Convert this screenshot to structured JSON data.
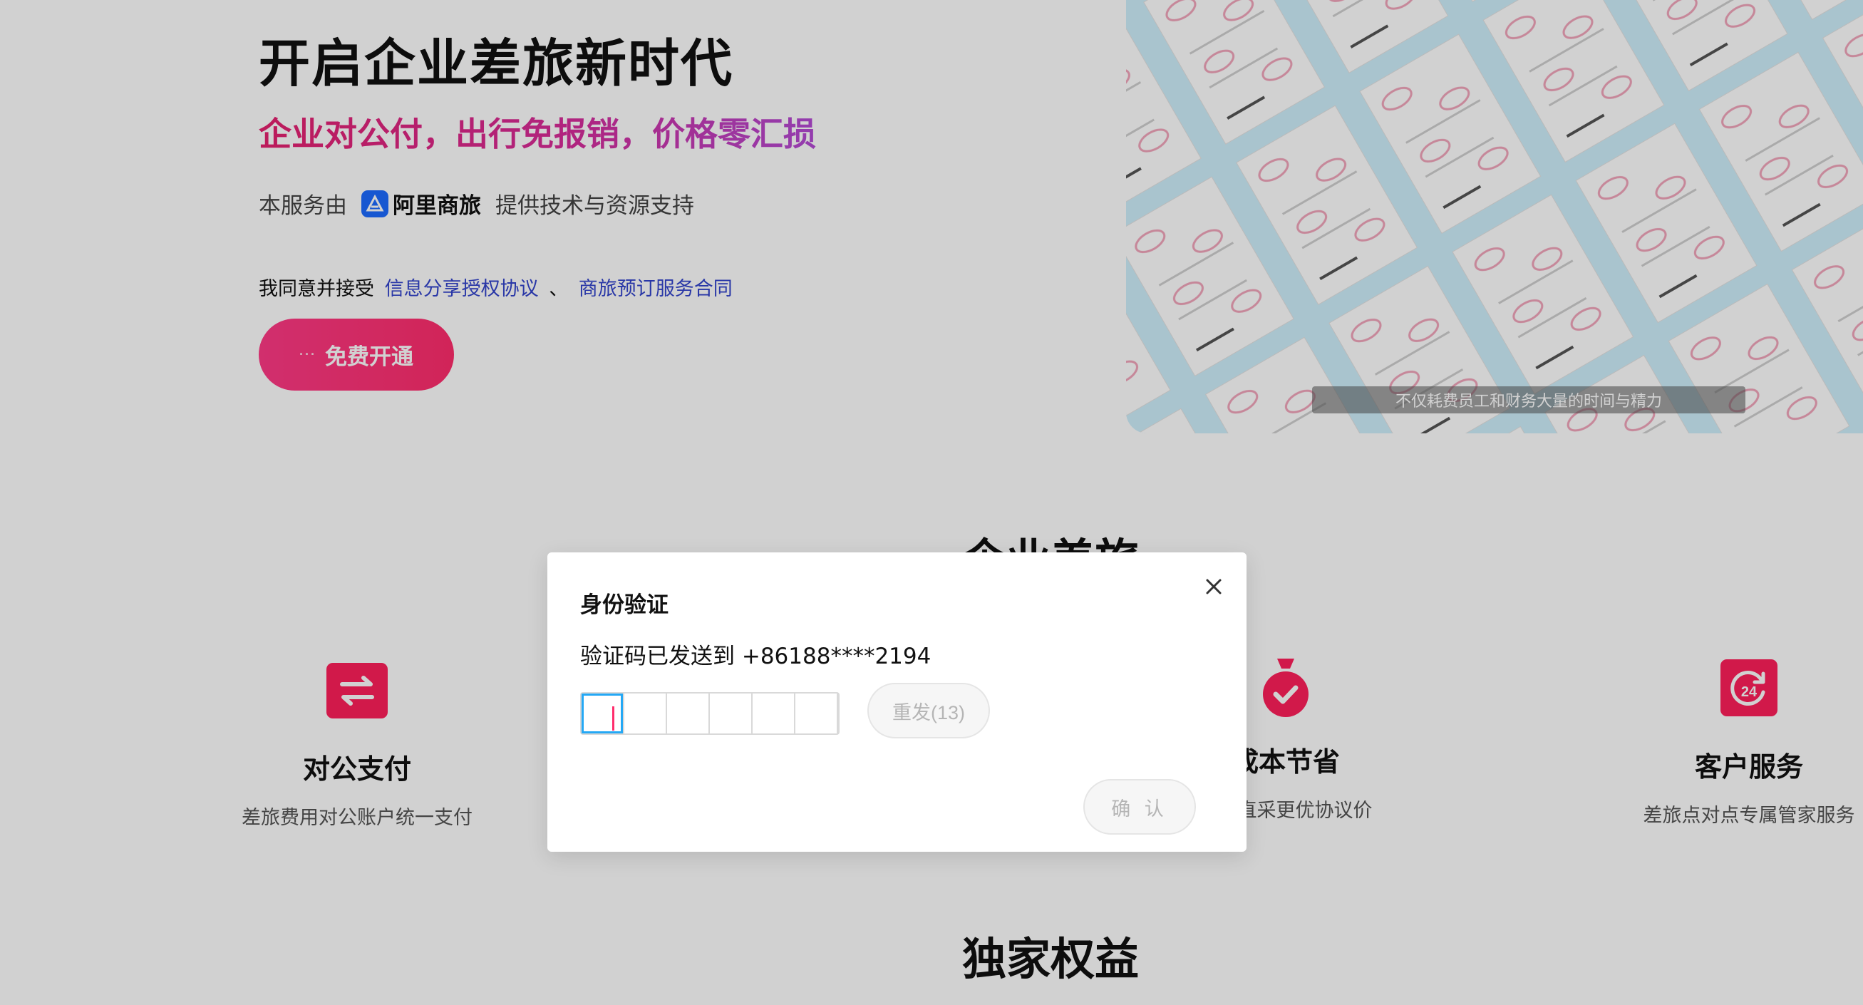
{
  "hero": {
    "title": "开启企业差旅新时代",
    "subtitle": "企业对公付，出行免报销，价格零汇损",
    "provider_prefix": "本服务由",
    "provider_name": "阿里商旅",
    "provider_suffix": "提供技术与资源支持",
    "agree_prefix": "我同意并接受",
    "agreement_link_1": "信息分享授权协议",
    "agree_separator": "、",
    "agreement_link_2": "商旅预订服务合同",
    "cta_dots": "···",
    "cta_label": "免费开通",
    "image_caption": "不仅耗费员工和财务大量的时间与精力"
  },
  "sections": {
    "business_travel_title": "企业差旅",
    "exclusive_title": "独家权益"
  },
  "features": [
    {
      "title": "对公支付",
      "desc": "差旅费用对公账户统一支付",
      "icon": "exchange-icon"
    },
    {
      "title": "成本节省",
      "desc": "企业直采更优协议价",
      "icon": "money-bag-check-icon"
    },
    {
      "title": "客户服务",
      "desc": "差旅点对点专属管家服务",
      "icon": "service-24h-icon"
    }
  ],
  "modal": {
    "title": "身份验证",
    "message": "验证码已发送到 +86188****2194",
    "resend_label": "重发(13)",
    "confirm_label": "确 认",
    "code_length": 6
  },
  "colors": {
    "accent": "#ff2d6c",
    "link": "#3344cc",
    "focus": "#24a8f5",
    "overlay": "rgba(0,0,0,0.18)"
  }
}
